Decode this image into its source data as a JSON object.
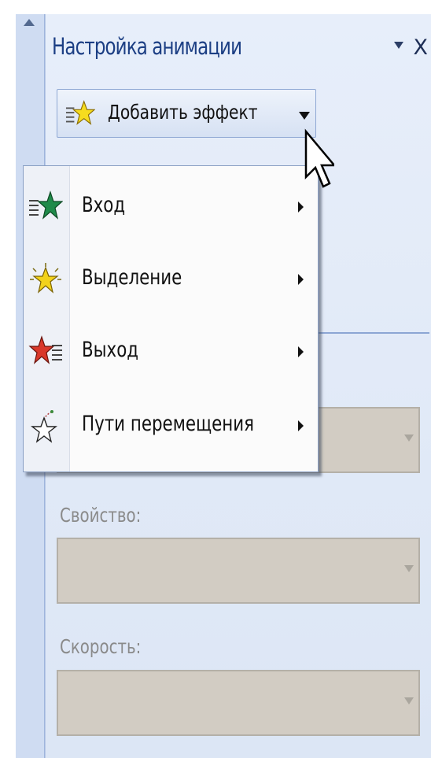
{
  "pane": {
    "title": "Настройка анимации",
    "close_label": "X"
  },
  "add_effect": {
    "label": "Добавить эффект"
  },
  "menu": {
    "items": [
      {
        "label": "Вход",
        "icon": "entrance-star-icon"
      },
      {
        "label": "Выделение",
        "icon": "emphasis-star-icon"
      },
      {
        "label": "Выход",
        "icon": "exit-star-icon"
      },
      {
        "label": "Пути перемещения",
        "icon": "motion-path-star-icon"
      }
    ]
  },
  "fields": {
    "property_label": "Свойство:",
    "speed_label": "Скорость:"
  },
  "colors": {
    "entrance": "#1f8a4a",
    "emphasis": "#f2d21b",
    "exit": "#d9382a",
    "title": "#1c3f84"
  }
}
